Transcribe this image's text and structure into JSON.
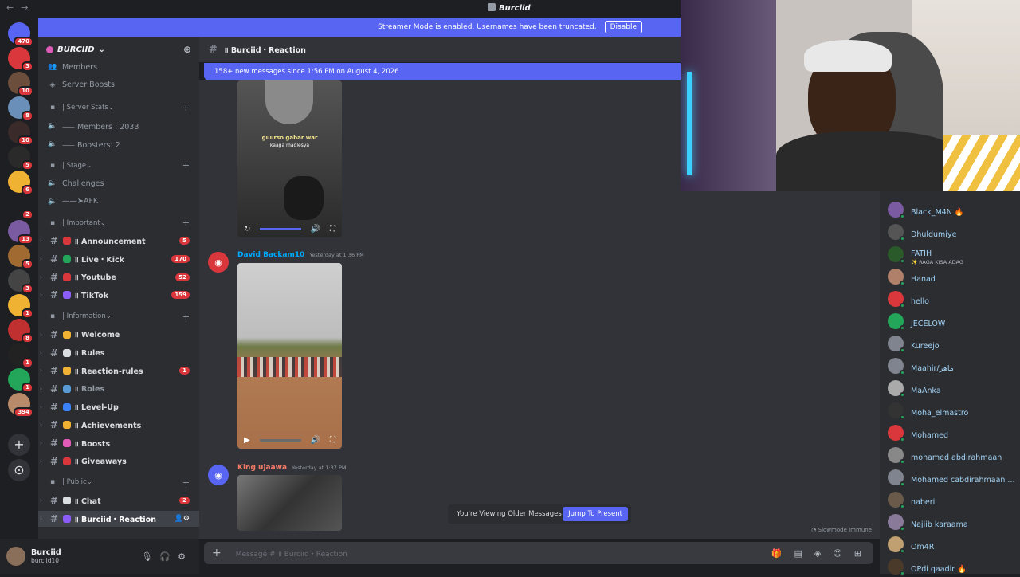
{
  "window": {
    "title": "Burciid"
  },
  "banner": {
    "text": "Streamer Mode is enabled. Usernames have been truncated.",
    "button": "Disable"
  },
  "server_rail": [
    {
      "badge": "470",
      "color": "#5865f2"
    },
    {
      "badge": "3",
      "color": "#da373c"
    },
    {
      "badge": "10",
      "color": "#6b4f3c"
    },
    {
      "badge": "8",
      "color": "#6a8fb8"
    },
    {
      "badge": "10",
      "color": "#3a2a2a"
    },
    {
      "badge": "5",
      "color": "#2a2a2a"
    },
    {
      "badge": "6",
      "color": "#f0b232"
    },
    {
      "badge": "2",
      "color": "#1e1f22"
    },
    {
      "badge": "13",
      "color": "#7a5aa0"
    },
    {
      "badge": "5",
      "color": "#a06a30"
    },
    {
      "badge": "3",
      "color": "#444"
    },
    {
      "badge": "1",
      "color": "#f0b232"
    },
    {
      "badge": "8",
      "color": "#c03030"
    },
    {
      "badge": "1",
      "color": "#222"
    },
    {
      "badge": "1",
      "color": "#23a55a"
    },
    {
      "badge": "394",
      "color": "#b88a6a"
    }
  ],
  "sidebar": {
    "guild_name": "BURCIID",
    "top_items": [
      "Members",
      "Server Boosts"
    ],
    "categories": [
      {
        "name": "| Server Stats",
        "items": [
          "⸺ Members : 2033",
          "⸺ Boosters: 2"
        ]
      },
      {
        "name": "| Stage",
        "items": [
          "Challenges",
          "——➤AFK"
        ]
      },
      {
        "name": "| Important",
        "channels": [
          {
            "name": "॥ Announcement",
            "count": "5",
            "emoji_color": "#da373c"
          },
          {
            "name": "॥ Live・Kick",
            "count": "170",
            "emoji_color": "#23a55a"
          },
          {
            "name": "॥ Youtube",
            "count": "52",
            "emoji_color": "#da373c"
          },
          {
            "name": "॥ TikTok",
            "count": "159",
            "emoji_color": "#8b5cf6"
          }
        ]
      },
      {
        "name": "| Information",
        "channels": [
          {
            "name": "॥ Welcome",
            "count": "",
            "emoji_color": "#f0b232"
          },
          {
            "name": "॥ Rules",
            "count": "",
            "emoji_color": "#dbdee1"
          },
          {
            "name": "॥ Reaction-rules",
            "count": "1",
            "emoji_color": "#f0b232"
          },
          {
            "name": "॥ Roles",
            "count": "",
            "emoji_color": "#5a9bd5",
            "muted": true
          },
          {
            "name": "॥ Level-Up",
            "count": "",
            "emoji_color": "#3b82f6"
          },
          {
            "name": "॥ Achievements",
            "count": "",
            "emoji_color": "#f0b232"
          },
          {
            "name": "॥ Boosts",
            "count": "",
            "emoji_color": "#e05ab8"
          },
          {
            "name": "॥ Giveaways",
            "count": "",
            "emoji_color": "#da373c"
          }
        ]
      },
      {
        "name": "| Public",
        "channels": [
          {
            "name": "॥ Chat",
            "count": "2",
            "emoji_color": "#dbdee1"
          },
          {
            "name": "॥ Burciid・Reaction",
            "count": "",
            "emoji_color": "#8b5cf6",
            "selected": true
          }
        ]
      }
    ]
  },
  "user_panel": {
    "name": "Burciid",
    "status": "burciid10"
  },
  "chat": {
    "channel_title": "॥ Burciid・Reaction",
    "new_messages": "158+ new messages since 1:56 PM on August 4, 2026",
    "video1_caption": "guurso gabar war",
    "video1_caption2": "kaaga maqlesya",
    "messages": [
      {
        "author": "David Backam10",
        "time": "Yesterday at 1:36 PM",
        "author_color": "#00a8fc"
      },
      {
        "author": "King ujaawa",
        "time": "Yesterday at 1:37 PM",
        "author_color": "#f47b67"
      }
    ],
    "older_notice": "You're Viewing Older Messages",
    "jump_button": "Jump To Present",
    "slowmode": "Slowmode Immune",
    "composer_placeholder": "Message # ॥ Burciid・Reaction"
  },
  "members": [
    {
      "name": "Black_M4N 🔥",
      "sub": "",
      "color": "#7a5aa0"
    },
    {
      "name": "Dhuldumiye",
      "sub": "",
      "color": "#555"
    },
    {
      "name": "FATIH",
      "sub": "✨ RAGA KISA ADAG",
      "color": "#2a5a2a"
    },
    {
      "name": "Hanad",
      "sub": "",
      "color": "#b0806a"
    },
    {
      "name": "hello",
      "sub": "",
      "color": "#da373c"
    },
    {
      "name": "JECELOW",
      "sub": "",
      "color": "#23a55a"
    },
    {
      "name": "Kureejo",
      "sub": "",
      "color": "#80848e"
    },
    {
      "name": "Maahir/ماهر",
      "sub": "",
      "color": "#80848e"
    },
    {
      "name": "MaAnka",
      "sub": "",
      "color": "#aaa"
    },
    {
      "name": "Moha_elmastro",
      "sub": "",
      "color": "#333"
    },
    {
      "name": "Mohamed",
      "sub": "",
      "color": "#da373c"
    },
    {
      "name": "mohamed abdirahmaan",
      "sub": "",
      "color": "#888"
    },
    {
      "name": "Mohamed cabdirahmaan ...",
      "sub": "",
      "color": "#80848e"
    },
    {
      "name": "naberi",
      "sub": "",
      "color": "#6a5a4a"
    },
    {
      "name": "Najiib karaama",
      "sub": "",
      "color": "#8a7a9a"
    },
    {
      "name": "Om4R",
      "sub": "",
      "color": "#c0a070"
    },
    {
      "name": "OPdi qaadir 🔥",
      "sub": "",
      "color": "#4a3a2a"
    }
  ]
}
